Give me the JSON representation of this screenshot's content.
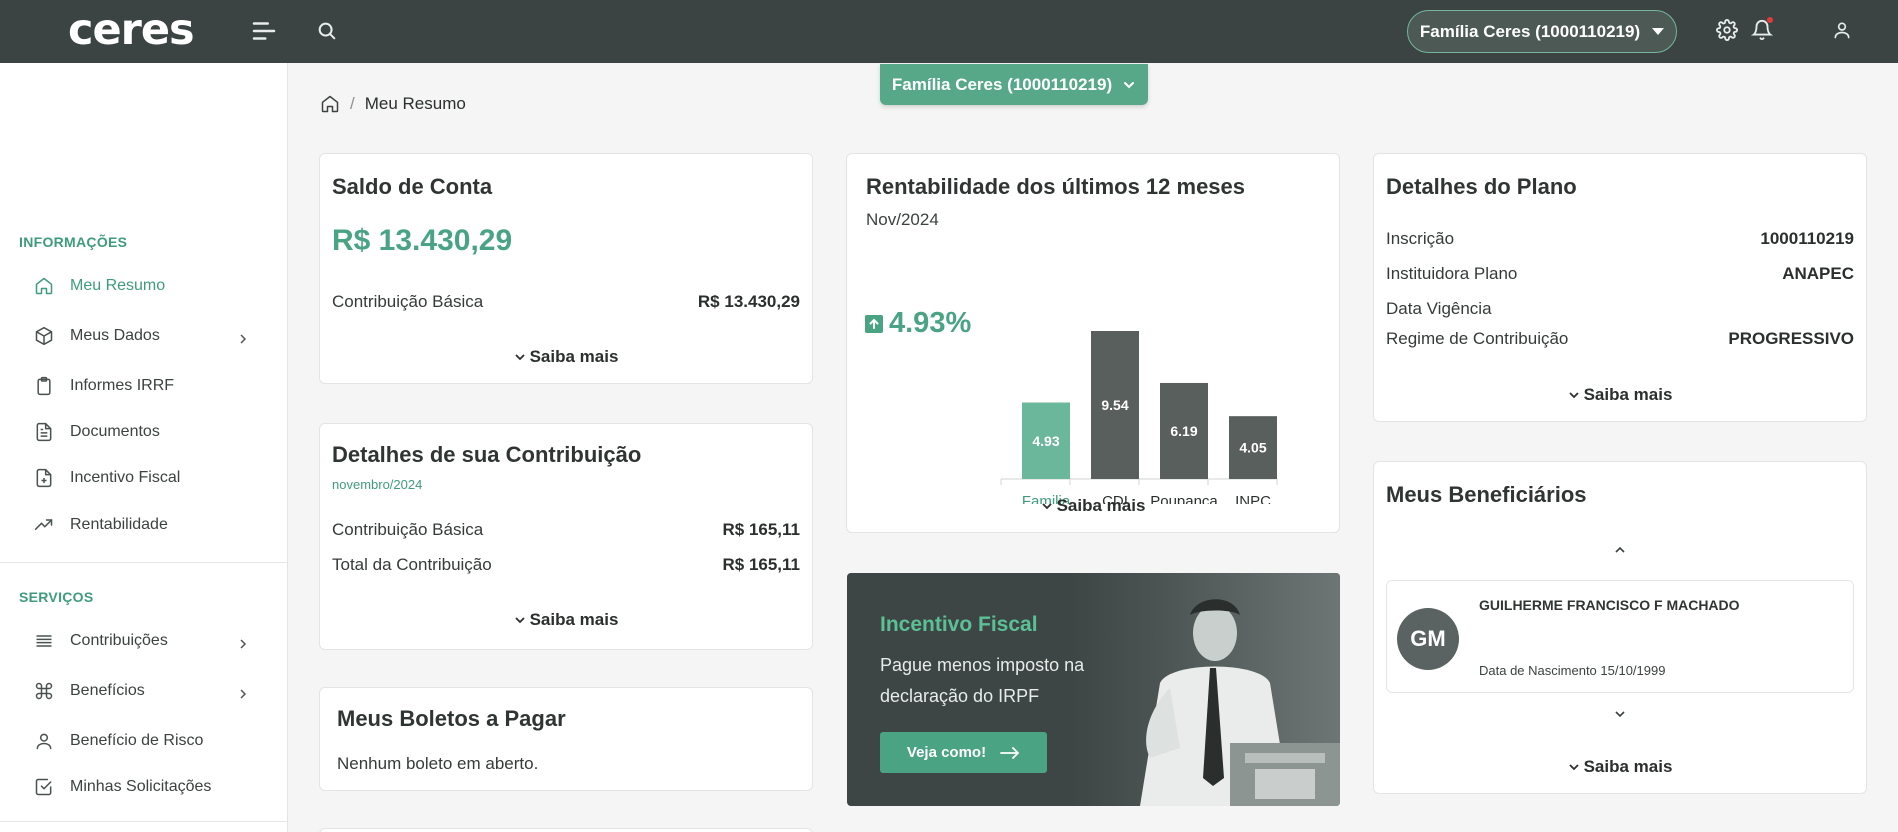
{
  "topbar": {
    "logo_text": "ceres",
    "plan_pill": "Família Ceres (1000110219)"
  },
  "plan_select": "Família Ceres (1000110219)",
  "breadcrumb": {
    "current": "Meu Resumo",
    "separator": "/"
  },
  "sidebar": {
    "section_info": "INFORMAÇÕES",
    "info_items": [
      {
        "label": "Meu Resumo",
        "icon": "home-icon",
        "active": true
      },
      {
        "label": "Meus Dados",
        "icon": "cube-icon",
        "has_submenu": true
      },
      {
        "label": "Informes IRRF",
        "icon": "clipboard-icon"
      },
      {
        "label": "Documentos",
        "icon": "document-icon"
      },
      {
        "label": "Incentivo Fiscal",
        "icon": "file-plus-icon"
      },
      {
        "label": "Rentabilidade",
        "icon": "trending-up-icon"
      }
    ],
    "section_services": "SERVIÇOS",
    "service_items": [
      {
        "label": "Contribuições",
        "icon": "list-icon",
        "has_submenu": true
      },
      {
        "label": "Benefícios",
        "icon": "command-icon",
        "has_submenu": true
      },
      {
        "label": "Benefício de Risco",
        "icon": "user-icon"
      },
      {
        "label": "Minhas Solicitações",
        "icon": "check-square-icon"
      }
    ]
  },
  "saldo": {
    "title": "Saldo de Conta",
    "amount": "R$ 13.430,29",
    "rows": [
      {
        "label": "Contribuição Básica",
        "value": "R$ 13.430,29"
      }
    ],
    "more": "Saiba mais"
  },
  "contribuicao": {
    "title": "Detalhes de sua Contribuição",
    "period": "novembro/2024",
    "rows": [
      {
        "label": "Contribuição Básica",
        "value": "R$ 165,11"
      },
      {
        "label": "Total da Contribuição",
        "value": "R$ 165,11"
      }
    ],
    "more": "Saiba mais"
  },
  "boletos": {
    "title": "Meus Boletos a Pagar",
    "empty": "Nenhum boleto em aberto."
  },
  "rentabilidade": {
    "title": "Rentabilidade dos últimos 12 meses",
    "period": "Nov/2024",
    "kpi": "4.93%",
    "more": "Saiba mais"
  },
  "chart_data": {
    "type": "bar",
    "title": "",
    "categories": [
      "Familia",
      "CDI",
      "Poupança",
      "INPC"
    ],
    "values": [
      4.93,
      9.54,
      6.19,
      4.05
    ],
    "value_labels": [
      "4.93",
      "9.54",
      "6.19",
      "4.05"
    ],
    "colors": [
      "#6bb79b",
      "#585f5d",
      "#585f5d",
      "#585f5d"
    ],
    "highlight_label_color": "#3f9c7b",
    "ylim": [
      0,
      9.54
    ],
    "grid": false,
    "xlabel": "",
    "ylabel": ""
  },
  "promo": {
    "title": "Incentivo Fiscal",
    "text": "Pague menos imposto na declaração do IRPF",
    "button": "Veja como!"
  },
  "plano": {
    "title": "Detalhes do Plano",
    "rows": [
      {
        "label": "Inscrição",
        "value": "1000110219"
      },
      {
        "label": "Instituidora Plano",
        "value": "ANAPEC"
      },
      {
        "label": "Data Vigência",
        "value": ""
      },
      {
        "label": "Regime de Contribuição",
        "value": "PROGRESSIVO"
      }
    ],
    "more": "Saiba mais"
  },
  "beneficiarios": {
    "title": "Meus Beneficiários",
    "items": [
      {
        "initials": "GM",
        "name": "GUILHERME FRANCISCO F MACHADO",
        "birth": "Data de Nascimento 15/10/1999"
      }
    ],
    "more": "Saiba mais"
  },
  "colors": {
    "topbar": "#3b4442",
    "accent": "#4aa483",
    "dark": "#585f5d"
  }
}
